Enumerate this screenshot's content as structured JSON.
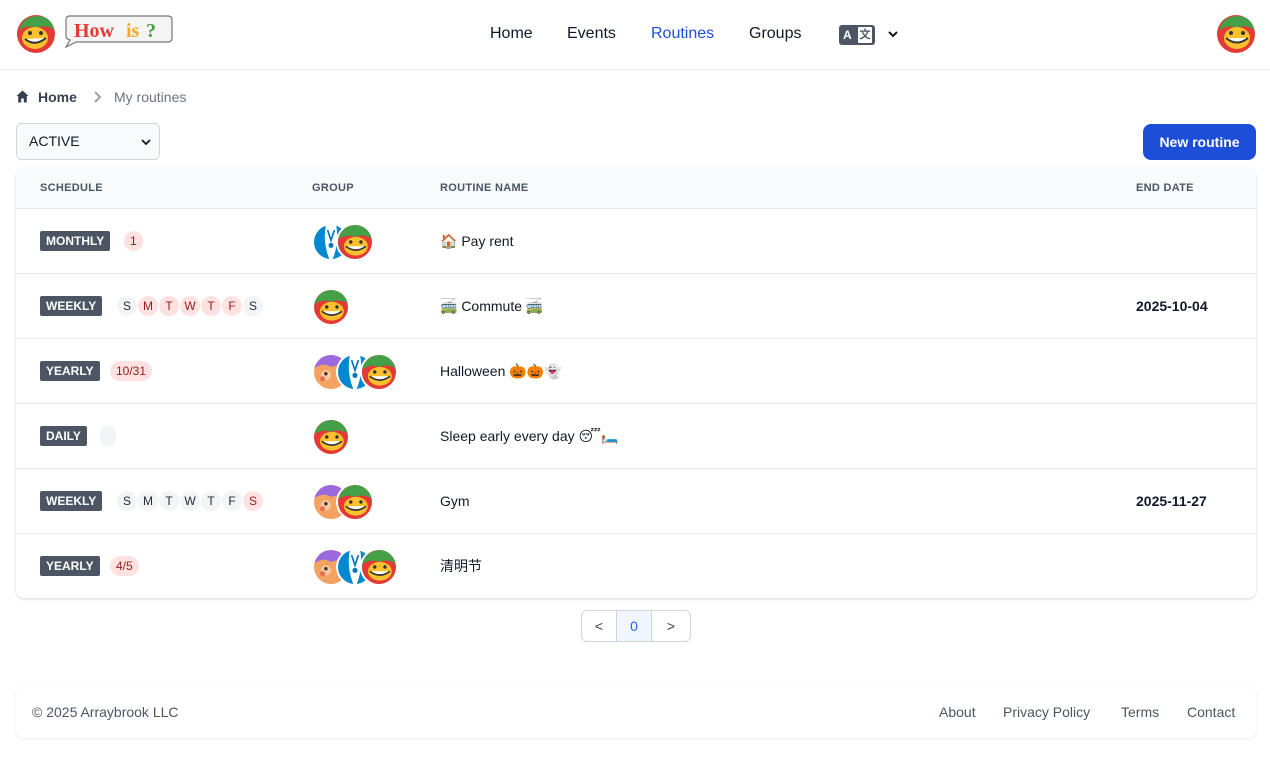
{
  "header": {
    "logo_text": "How is?",
    "nav": [
      {
        "label": "Home",
        "active": false
      },
      {
        "label": "Events",
        "active": false
      },
      {
        "label": "Routines",
        "active": true
      },
      {
        "label": "Groups",
        "active": false
      }
    ],
    "language_icon": "translate-icon"
  },
  "breadcrumb": {
    "home": "Home",
    "current": "My routines"
  },
  "filter": {
    "selected": "ACTIVE"
  },
  "new_button": "New routine",
  "table": {
    "headers": {
      "schedule": "SCHEDULE",
      "group": "GROUP",
      "name": "ROUTINE NAME",
      "end_date": "END DATE"
    },
    "rows": [
      {
        "schedule": "MONTHLY",
        "detail": "1",
        "group": [
          "blue-figure",
          "green-face"
        ],
        "name": "🏠 Pay rent",
        "end_date": ""
      },
      {
        "schedule": "WEEKLY",
        "days": [
          {
            "d": "S",
            "on": false
          },
          {
            "d": "M",
            "on": true
          },
          {
            "d": "T",
            "on": true
          },
          {
            "d": "W",
            "on": true
          },
          {
            "d": "T",
            "on": true
          },
          {
            "d": "F",
            "on": true
          },
          {
            "d": "S",
            "on": false
          }
        ],
        "group": [
          "green-face"
        ],
        "name": "🚎 Commute 🚎",
        "end_date": "2025-10-04"
      },
      {
        "schedule": "YEARLY",
        "detail": "10/31",
        "group": [
          "purple-face",
          "blue-figure",
          "green-face"
        ],
        "name": "Halloween 🎃🎃👻",
        "end_date": ""
      },
      {
        "schedule": "DAILY",
        "detail": "",
        "group": [
          "green-face"
        ],
        "name": "Sleep early every day 😴🛏️",
        "end_date": ""
      },
      {
        "schedule": "WEEKLY",
        "days": [
          {
            "d": "S",
            "on": false
          },
          {
            "d": "M",
            "on": false
          },
          {
            "d": "T",
            "on": false
          },
          {
            "d": "W",
            "on": false
          },
          {
            "d": "T",
            "on": false
          },
          {
            "d": "F",
            "on": false
          },
          {
            "d": "S",
            "on": true
          }
        ],
        "group": [
          "purple-face",
          "green-face"
        ],
        "name": "Gym",
        "end_date": "2025-11-27"
      },
      {
        "schedule": "YEARLY",
        "detail": "4/5",
        "group": [
          "purple-face",
          "blue-figure",
          "green-face"
        ],
        "name": "清明节",
        "end_date": ""
      }
    ]
  },
  "pagination": {
    "prev": "<",
    "current": "0",
    "next": ">"
  },
  "footer": {
    "copyright": "© 2025 Arraybrook LLC",
    "links": [
      "About",
      "Privacy Policy",
      "Terms",
      "Contact"
    ]
  },
  "colors": {
    "accent": "#1d4ed8",
    "badge": "#4b5563",
    "pill_bg": "#fee2e2",
    "pill_text": "#991b1b"
  }
}
